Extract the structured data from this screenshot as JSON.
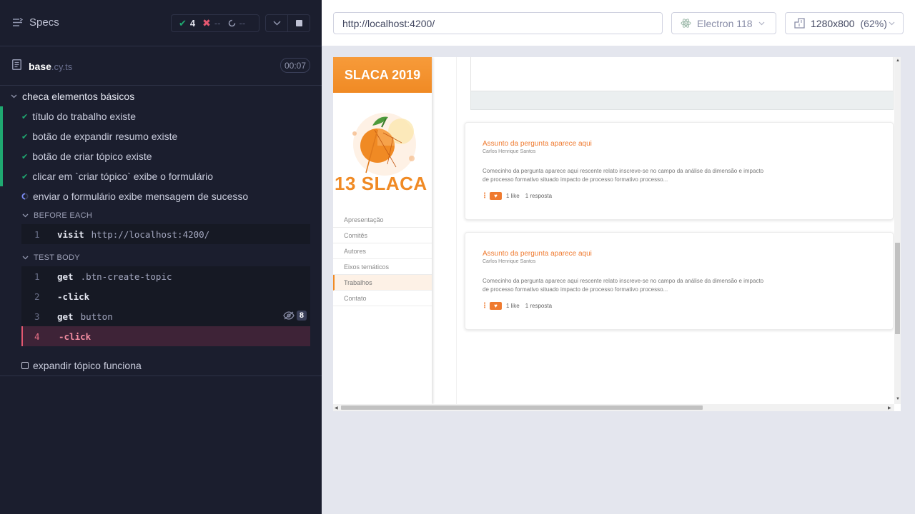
{
  "reporter": {
    "specs_label": "Specs",
    "stats": {
      "passed": "4",
      "failed": "--",
      "pending": "--"
    },
    "spec": {
      "name": "base",
      "ext": ".cy.ts",
      "duration": "00:07"
    },
    "suite": {
      "title": "checa elementos básicos",
      "tests": [
        {
          "label": "título do trabalho existe",
          "state": "passed"
        },
        {
          "label": "botão de expandir resumo existe",
          "state": "passed"
        },
        {
          "label": "botão de criar tópico existe",
          "state": "passed"
        },
        {
          "label": "clicar em `criar tópico` exibe o formulário",
          "state": "passed"
        },
        {
          "label": "enviar o formulário exibe mensagem de sucesso",
          "state": "running"
        }
      ],
      "before_each": {
        "title": "BEFORE EACH",
        "commands": [
          {
            "num": "1",
            "name": "visit",
            "message": "http://localhost:4200/"
          }
        ]
      },
      "test_body": {
        "title": "TEST BODY",
        "commands": [
          {
            "num": "1",
            "name": "get",
            "message": ".btn-create-topic"
          },
          {
            "num": "2",
            "name": "-click",
            "message": ""
          },
          {
            "num": "3",
            "name": "get",
            "message": "button",
            "hidden_count": "8"
          },
          {
            "num": "4",
            "name": "-click",
            "message": "",
            "state": "failed"
          }
        ]
      },
      "pending_test": {
        "label": "expandir tópico funciona",
        "state": "pending"
      }
    }
  },
  "runner": {
    "url": "http://localhost:4200/",
    "browser": "Electron 118",
    "viewport": "1280x800",
    "scale": "(62%)"
  },
  "app": {
    "brand": "SLACA 2019",
    "logo_text": "13 SLACA",
    "menu": [
      {
        "label": "Apresentação",
        "active": false
      },
      {
        "label": "Comitês",
        "active": false
      },
      {
        "label": "Autores",
        "active": false
      },
      {
        "label": "Eixos temáticos",
        "active": false
      },
      {
        "label": "Trabalhos",
        "active": true
      },
      {
        "label": "Contato",
        "active": false
      }
    ],
    "cards": [
      {
        "title": "Assunto da pergunta aparece aqui",
        "author": "Carlos Henrique Santos",
        "body_line1": "Comecinho da pergunta aparece aqui rescente relato inscreve-se no campo da análise da dimensão e impacto",
        "body_line2": "de processo formativo situado impacto de processo formativo processo...",
        "likes": "1 like",
        "replies": "1 resposta"
      },
      {
        "title": "Assunto da pergunta aparece aqui",
        "author": "Carlos Henrique Santos",
        "body_line1": "Comecinho da pergunta aparece aqui rescente relato inscreve-se no campo da análise da dimensão e impacto",
        "body_line2": "de processo formativo situado impacto de processo formativo processo...",
        "likes": "1 like",
        "replies": "1 resposta"
      }
    ]
  },
  "colors": {
    "reporter_bg": "#1b1e2e",
    "pass": "#1fa971",
    "fail": "#e45770",
    "brand_orange": "#f08a24"
  }
}
